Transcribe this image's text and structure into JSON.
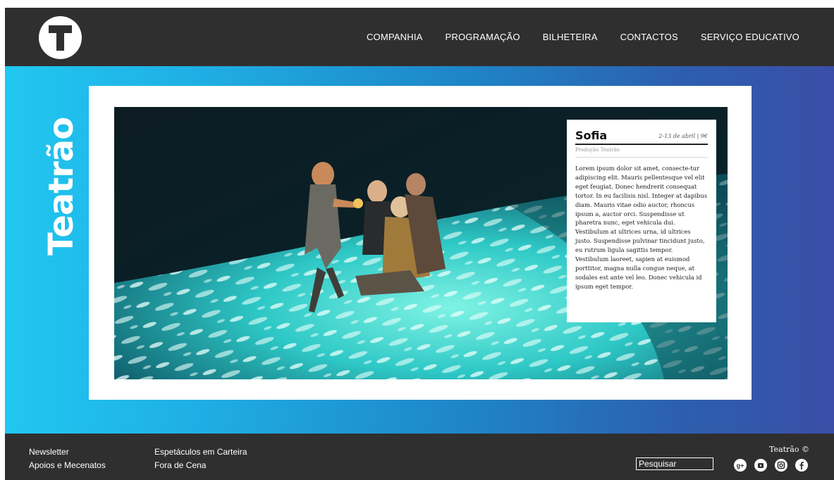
{
  "header": {
    "logo_letter": "T",
    "nav": [
      "COMPANHIA",
      "PROGRAMAÇÃO",
      "BILHETEIRA",
      "CONTACTOS",
      "SERVIÇO EDUCATIVO"
    ]
  },
  "hero": {
    "vertical_title": "Teatrão",
    "card": {
      "title": "Sofia",
      "date": "2-13 de abril | 9€",
      "subtitle": "Produção Teatrão",
      "body": "Lorem ipsum dolor sit amet, consecte-tur adipiscing elit. Mauris pellentesque vel elit eget feugiat. Donec hendrerit consequat tortor. In eu facilisis nisl. Integer at dapibus diam. Mauris vitae odio auctor, rhoncus ipsum a, auctor orci. Suspendisse ut pharetra nunc, eget vehicula dui. Vestibulum at ultrices urna, id ultrices justo. Suspendisse pulvinar tincidunt justo, eu rutrum ligula sagittis tempor. Vestibulum laoreet, sapien at euismod porttitor, magna nulla congue neque, at sodales est ante vel leo. Donec vehicula id ipsum eget tempor."
    }
  },
  "footer": {
    "links_col1": [
      "Newsletter",
      "Apoios e Mecenatos"
    ],
    "links_col2": [
      "Espetáculos em Carteira",
      "Fora de Cena"
    ],
    "search_placeholder": "Pesquisar",
    "copyright": "Teatrão ©",
    "social": [
      {
        "icon": "google-plus-icon"
      },
      {
        "icon": "youtube-icon"
      },
      {
        "icon": "instagram-icon"
      },
      {
        "icon": "facebook-icon"
      }
    ]
  },
  "colors": {
    "header_bg": "#302f2f",
    "gradient_left": "#21c7f0",
    "gradient_right": "#3b4ea7",
    "footer_bg": "#302f2f"
  }
}
